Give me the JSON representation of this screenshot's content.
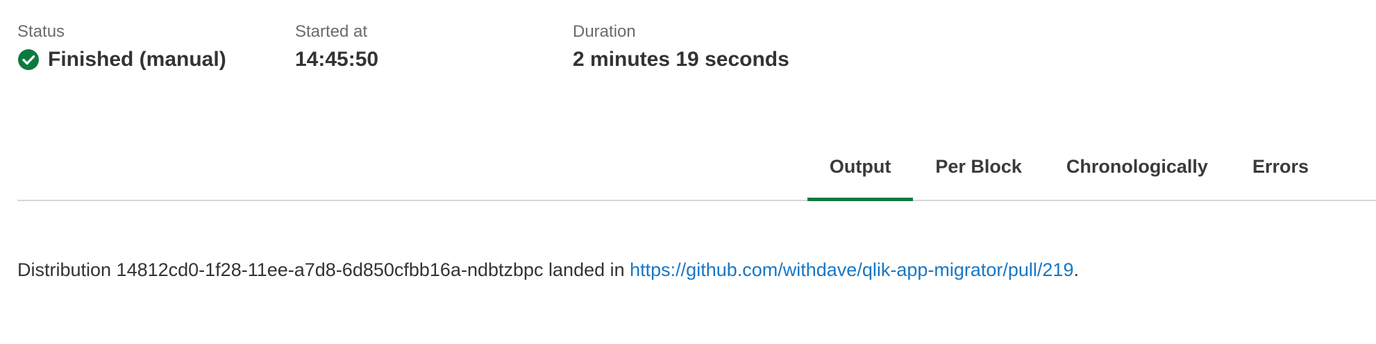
{
  "summary": {
    "status": {
      "label": "Status",
      "value": "Finished (manual)",
      "icon": "check-circle-icon",
      "color": "#0c7a3e"
    },
    "started": {
      "label": "Started at",
      "value": "14:45:50"
    },
    "duration": {
      "label": "Duration",
      "value": "2 minutes 19 seconds"
    }
  },
  "tabs": {
    "active": "Output",
    "accent": "#0c7a3e",
    "items": [
      {
        "label": "Output"
      },
      {
        "label": "Per Block"
      },
      {
        "label": "Chronologically"
      },
      {
        "label": "Errors"
      }
    ]
  },
  "output": {
    "prefix": "Distribution 14812cd0-1f28-11ee-a7d8-6d850cfbb16a-ndbtzbpc landed in ",
    "link": "https://github.com/withdave/qlik-app-migrator/pull/219",
    "suffix": "."
  }
}
